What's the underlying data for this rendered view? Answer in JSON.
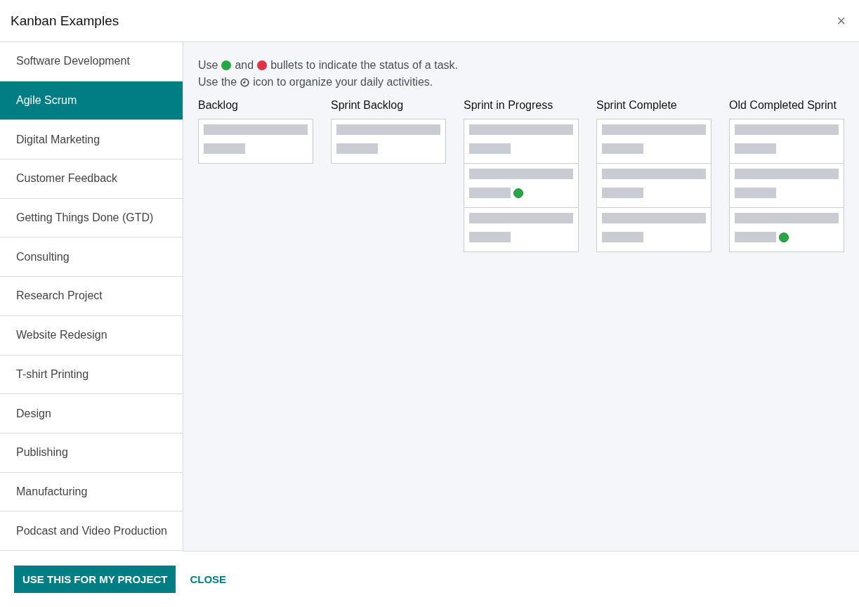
{
  "dialog": {
    "title": "Kanban Examples",
    "close_icon": "×"
  },
  "sidebar": {
    "items": [
      {
        "label": "Software Development",
        "selected": false
      },
      {
        "label": "Agile Scrum",
        "selected": true
      },
      {
        "label": "Digital Marketing",
        "selected": false
      },
      {
        "label": "Customer Feedback",
        "selected": false
      },
      {
        "label": "Getting Things Done (GTD)",
        "selected": false
      },
      {
        "label": "Consulting",
        "selected": false
      },
      {
        "label": "Research Project",
        "selected": false
      },
      {
        "label": "Website Redesign",
        "selected": false
      },
      {
        "label": "T-shirt Printing",
        "selected": false
      },
      {
        "label": "Design",
        "selected": false
      },
      {
        "label": "Publishing",
        "selected": false
      },
      {
        "label": "Manufacturing",
        "selected": false
      },
      {
        "label": "Podcast and Video Production",
        "selected": false
      }
    ]
  },
  "hints": [
    [
      {
        "kind": "text",
        "text": "Use"
      },
      {
        "kind": "green-dot"
      },
      {
        "kind": "text",
        "text": "and"
      },
      {
        "kind": "red-dot"
      },
      {
        "kind": "text",
        "text": "bullets to indicate the status of a task."
      }
    ],
    [
      {
        "kind": "text",
        "text": "Use the"
      },
      {
        "kind": "clock"
      },
      {
        "kind": "text",
        "text": "icon to organize your daily activities."
      }
    ]
  ],
  "columns": [
    {
      "title": "Backlog",
      "cards": [
        {
          "dot": false
        }
      ]
    },
    {
      "title": "Sprint Backlog",
      "cards": [
        {
          "dot": false
        }
      ]
    },
    {
      "title": "Sprint in Progress",
      "cards": [
        {
          "dot": false
        },
        {
          "dot": true
        },
        {
          "dot": false
        }
      ]
    },
    {
      "title": "Sprint Complete",
      "cards": [
        {
          "dot": false
        },
        {
          "dot": false
        },
        {
          "dot": false
        }
      ]
    },
    {
      "title": "Old Completed Sprint",
      "cards": [
        {
          "dot": false
        },
        {
          "dot": false
        },
        {
          "dot": true
        }
      ]
    }
  ],
  "footer": {
    "primary": "USE THIS FOR MY PROJECT",
    "secondary": "CLOSE"
  }
}
